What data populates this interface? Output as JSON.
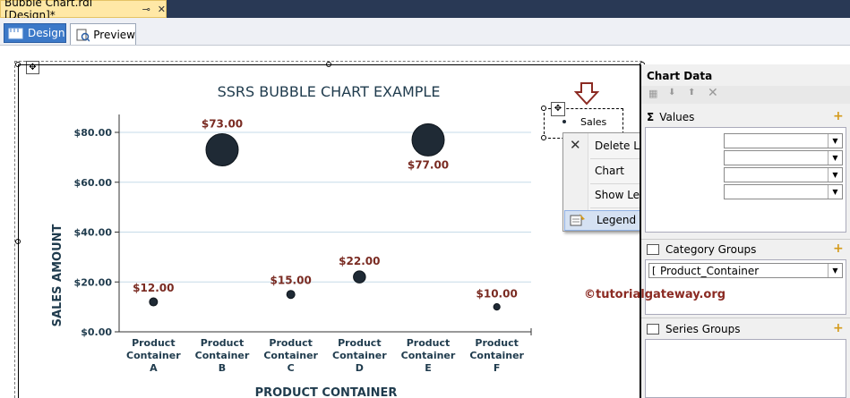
{
  "document_tab": {
    "title": "Bubble Chart.rdl [Design]*",
    "pin_icon": "pin-icon",
    "close_icon": "close-icon"
  },
  "view_tabs": [
    {
      "label": "Design",
      "active": true
    },
    {
      "label": "Preview",
      "active": false
    }
  ],
  "chart": {
    "title": "SSRS BUBBLE CHART EXAMPLE",
    "xlabel": "PRODUCT CONTAINER",
    "ylabel": "SALES AMOUNT",
    "legend_entry": "Sales"
  },
  "chart_data": {
    "type": "scatter",
    "title": "SSRS BUBBLE CHART EXAMPLE",
    "xlabel": "PRODUCT CONTAINER",
    "ylabel": "SALES AMOUNT",
    "ylim": [
      0,
      80
    ],
    "yticks": [
      "$0.00",
      "$20.00",
      "$40.00",
      "$60.00",
      "$80.00"
    ],
    "categories": [
      [
        "Product",
        "Container",
        "A"
      ],
      [
        "Product",
        "Container",
        "B"
      ],
      [
        "Product",
        "Container",
        "C"
      ],
      [
        "Product",
        "Container",
        "D"
      ],
      [
        "Product",
        "Container",
        "E"
      ],
      [
        "Product",
        "Container",
        "F"
      ]
    ],
    "series": [
      {
        "name": "Sales",
        "values": [
          12,
          73,
          15,
          22,
          77,
          10
        ]
      }
    ],
    "data_labels": [
      "$12.00",
      "$73.00",
      "$15.00",
      "$22.00",
      "$77.00",
      "$10.00"
    ],
    "bubble_size": [
      1,
      4,
      1,
      1.5,
      4,
      0.8
    ],
    "grid": true,
    "legend_position": "top-right",
    "colors": {
      "bubble": "#1f2a35",
      "label": "#7a2b22",
      "title": "#1f3b4d",
      "grid": "#c6dbe8"
    }
  },
  "context_menu": {
    "items": [
      {
        "label": "Delete Legend",
        "icon": "delete-icon"
      },
      {
        "label": "Chart",
        "icon": "submenu-arrow-icon"
      },
      {
        "label": "Show Legend Title"
      },
      {
        "label": "Legend Properties...",
        "icon": "properties-icon"
      }
    ]
  },
  "panel": {
    "title": "Chart Data",
    "values_label": "Values",
    "category_groups_label": "Category Groups",
    "category_value": "Product_Container",
    "series_groups_label": "Series Groups"
  },
  "watermark": "©tutorialgateway.org",
  "colors": {
    "accent": "#3c79c8",
    "tab_active": "#ffe8a6",
    "arrow": "#8b2a22"
  }
}
